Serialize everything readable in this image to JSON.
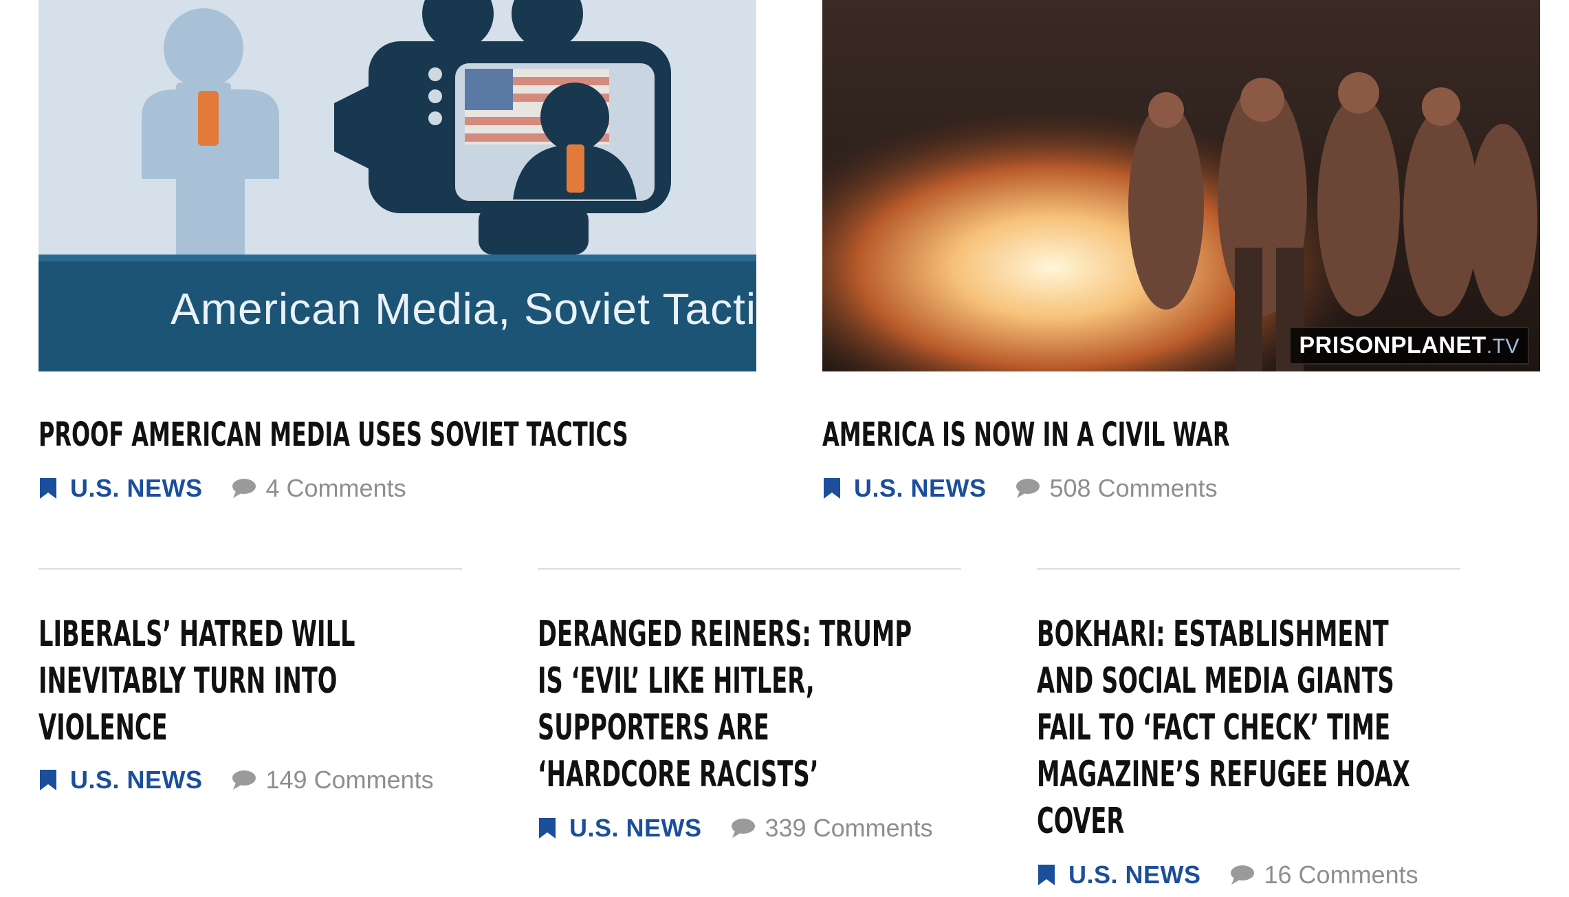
{
  "featured": [
    {
      "image": {
        "caption": "American Media, Soviet Tactics",
        "watermark": ""
      },
      "title": "PROOF AMERICAN MEDIA USES SOVIET TACTICS",
      "category": "U.S. NEWS",
      "comments": "4 Comments"
    },
    {
      "image": {
        "caption": "",
        "watermark_main": "PRISONPLANET",
        "watermark_tld": ".TV"
      },
      "title": "AMERICA IS NOW IN A CIVIL WAR",
      "category": "U.S. NEWS",
      "comments": "508 Comments"
    }
  ],
  "articles": [
    {
      "title_lines": [
        "LIBERALS’ HATRED WILL",
        "INEVITABLY TURN INTO",
        "VIOLENCE"
      ],
      "category": "U.S. NEWS",
      "comments": "149 Comments"
    },
    {
      "title_lines": [
        "DERANGED REINERS: TRUMP",
        "IS ‘EVIL’ LIKE HITLER,",
        "SUPPORTERS ARE",
        "‘HARDCORE RACISTS’"
      ],
      "category": "U.S. NEWS",
      "comments": "339 Comments"
    },
    {
      "title_lines": [
        "BOKHARI: ESTABLISHMENT",
        "AND SOCIAL MEDIA GIANTS",
        "FAIL TO ‘FACT CHECK’ TIME",
        "MAGAZINE’S REFUGEE HOAX",
        "COVER"
      ],
      "category": "U.S. NEWS",
      "comments": "16 Comments"
    }
  ],
  "colors": {
    "category_blue": "#1b4e9b",
    "comment_gray": "#8e8e8e",
    "headline": "#111111",
    "divider": "#dcdcdc"
  },
  "icons": {
    "category": "bookmark-icon",
    "comments": "comment-bubble-icon"
  }
}
